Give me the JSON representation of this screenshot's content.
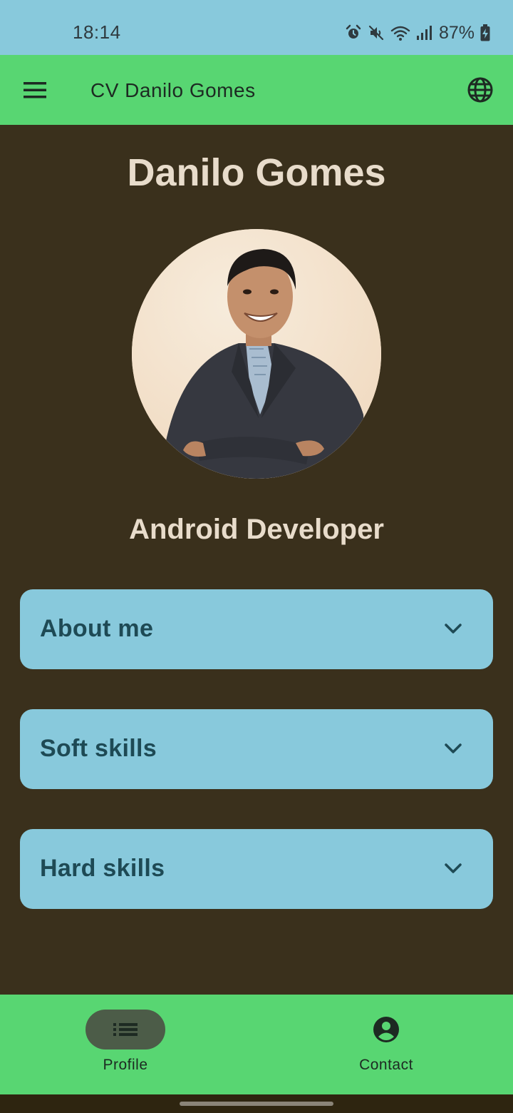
{
  "status_bar": {
    "time": "18:14",
    "battery": "87%",
    "icons": [
      "alarm-icon",
      "mute-icon",
      "wifi-icon",
      "signal-icon",
      "battery-charging-icon"
    ]
  },
  "app_bar": {
    "title": "CV Danilo Gomes",
    "menu_icon": "menu-icon",
    "language_icon": "globe-icon"
  },
  "profile": {
    "name": "Danilo Gomes",
    "role": "Android Developer"
  },
  "sections": [
    {
      "label": "About me"
    },
    {
      "label": "Soft skills"
    },
    {
      "label": "Hard skills"
    }
  ],
  "bottom_nav": {
    "items": [
      {
        "label": "Profile",
        "icon": "list-icon",
        "selected": true
      },
      {
        "label": "Contact",
        "icon": "account-circle-icon",
        "selected": false
      }
    ]
  },
  "colors": {
    "status_bar": "#88c9dc",
    "app_bar": "#58d672",
    "background": "#3a301c",
    "card": "#88c9dc",
    "card_text": "#1e4a55",
    "heading_text": "#e8dccb",
    "nav_pill": "#4c5c48"
  }
}
